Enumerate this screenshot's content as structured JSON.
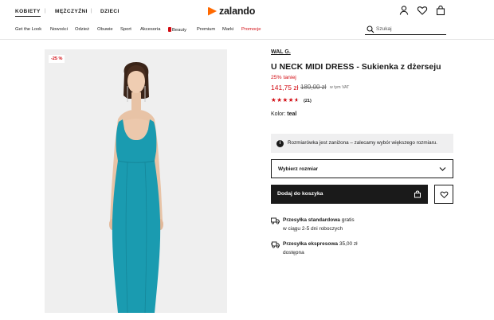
{
  "header": {
    "genders": [
      "KOBIETY",
      "MĘŻCZYŹNI",
      "DZIECI"
    ],
    "logo_text": "zalando",
    "icons": [
      "user-icon",
      "heart-icon",
      "bag-icon"
    ]
  },
  "nav": {
    "categories": [
      "Get the Look",
      "Nowości",
      "Odzież",
      "Obuwie",
      "Sport",
      "Akcesoria",
      "Beauty",
      "Premium",
      "Marki",
      "Promocje"
    ],
    "search_placeholder": "Szukaj"
  },
  "product": {
    "discount_badge": "-25 %",
    "brand": "WAL G.",
    "title": "U NECK MIDI DRESS - Sukienka z dżerseju",
    "discount_text": "25% taniej",
    "price": "141,75 zł",
    "old_price": "189,00 zł",
    "vat_note": "w tym VAT",
    "rating": 4.5,
    "rating_count": "(21)",
    "color_label": "Kolor:",
    "color_value": "teal",
    "size_note": "Rozmiarówka jest zaniżona – zalecamy wybór większego rozmiaru.",
    "size_select_label": "Wybierz rozmiar",
    "add_to_cart": "Dodaj do koszyka"
  },
  "shipping": [
    {
      "title": "Przesyłka standardowa",
      "price": "gratis",
      "detail": "w ciągu 2-5 dni roboczych"
    },
    {
      "title": "Przesyłka ekspresowa",
      "price": "35,00 zł",
      "detail": "dostępna"
    }
  ],
  "colors": {
    "accent": "#ff6900",
    "sale_red": "#d20a11",
    "dress_teal": "#1a9bb0",
    "primary_button": "#1a1a1a"
  }
}
